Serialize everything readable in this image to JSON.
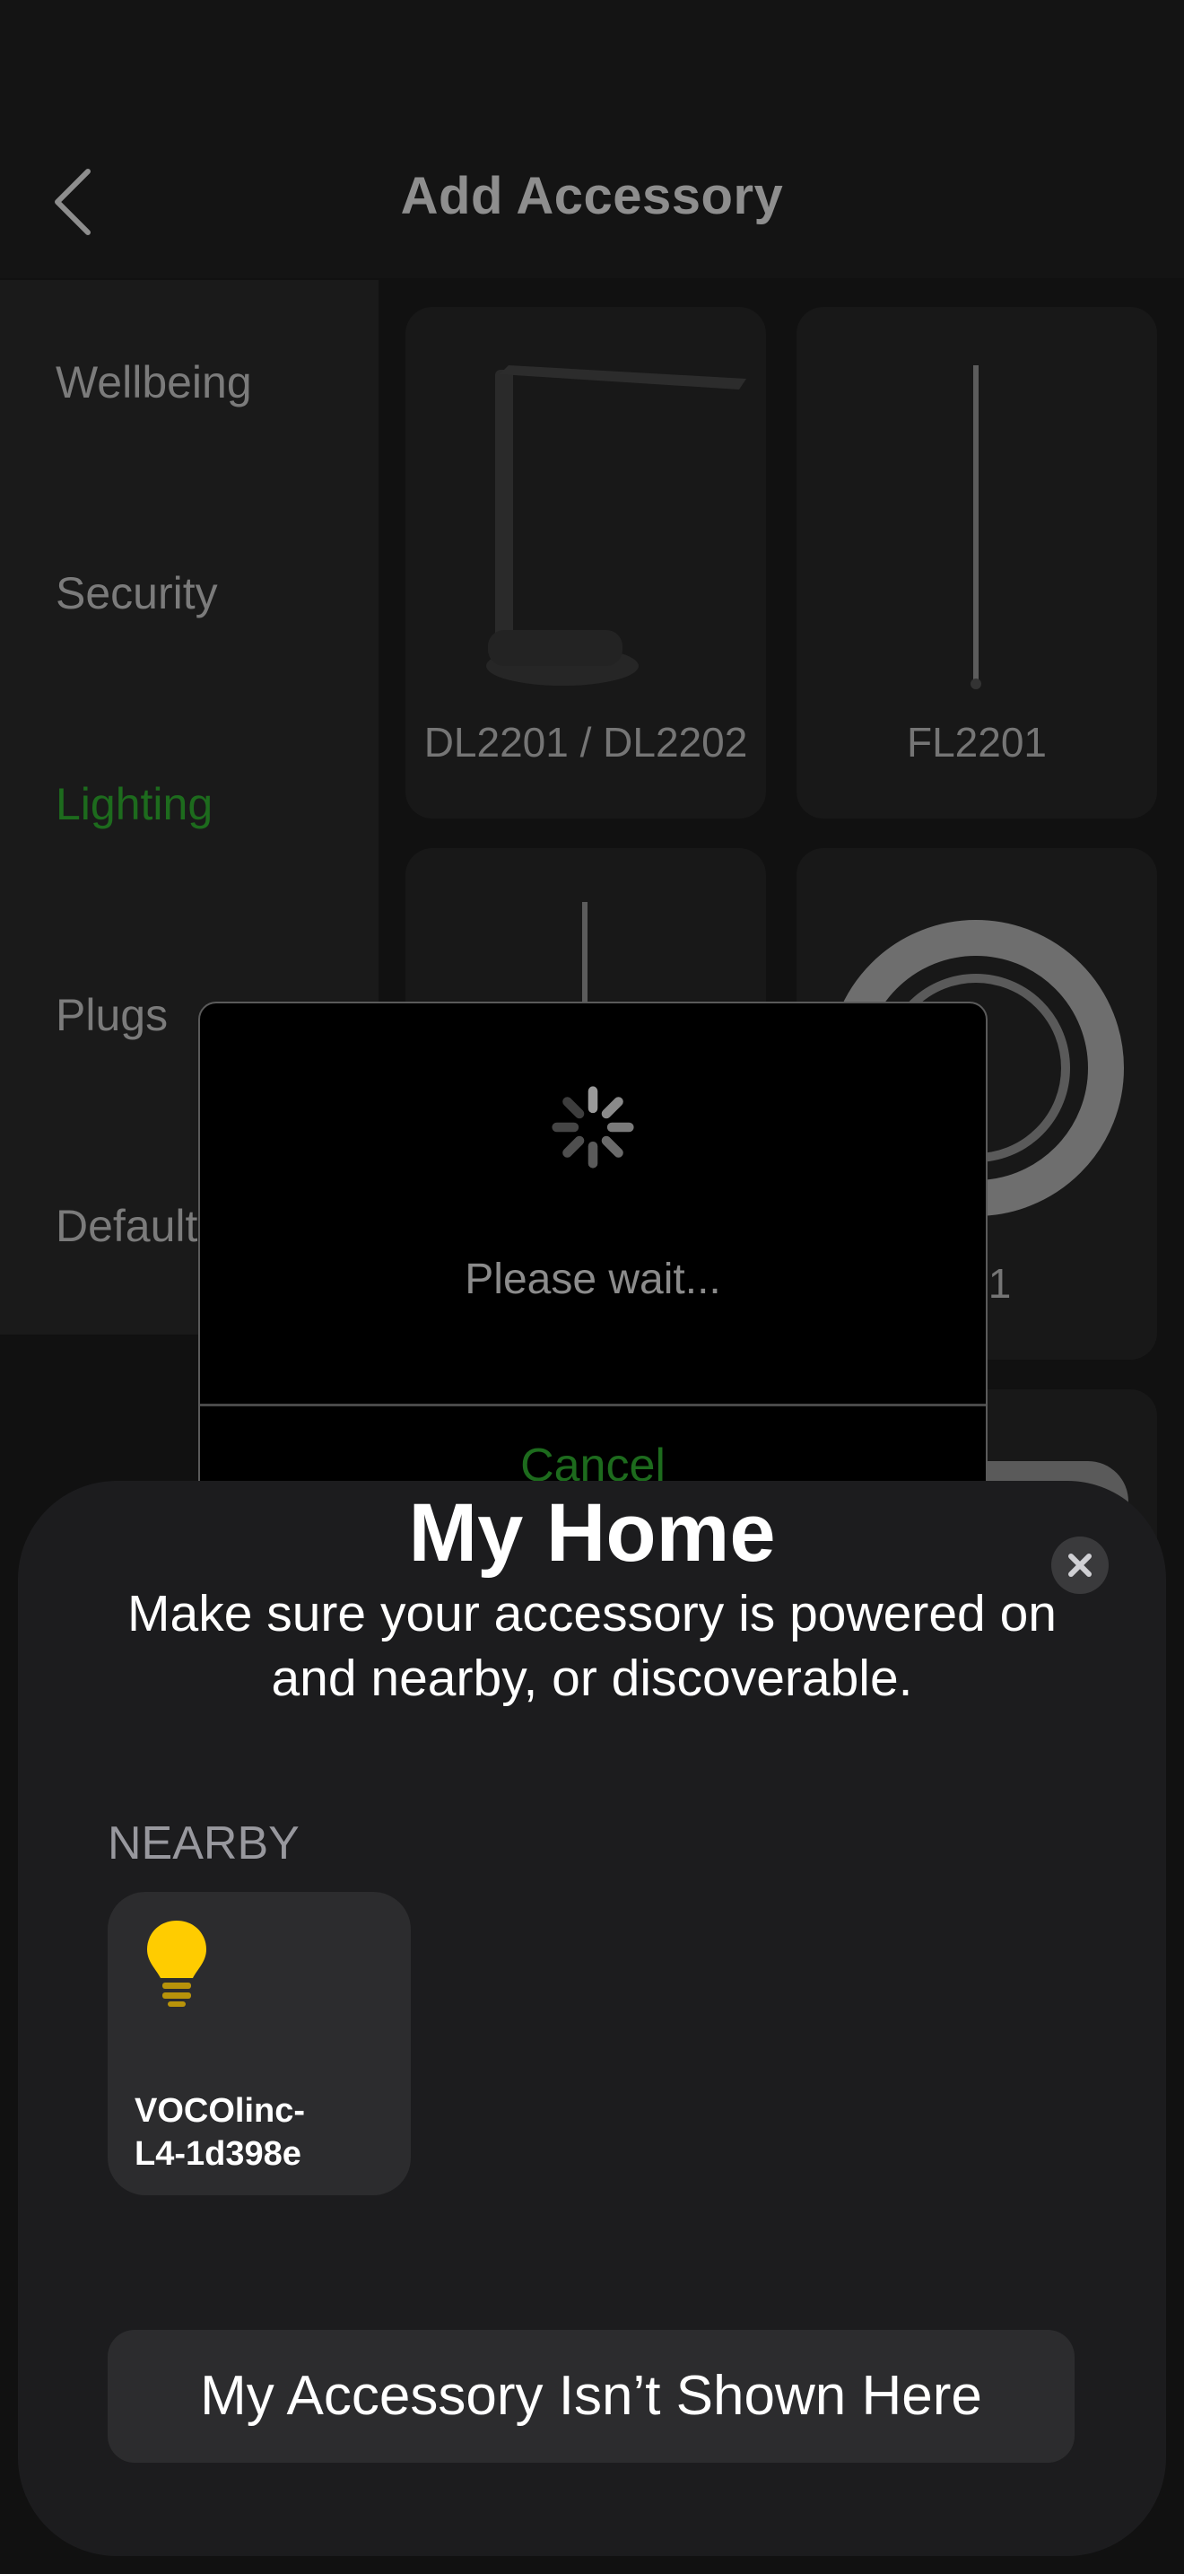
{
  "header": {
    "title": "Add Accessory",
    "back_icon": "chevron-left-icon"
  },
  "sidebar": {
    "items": [
      {
        "label": "Wellbeing"
      },
      {
        "label": "Security"
      },
      {
        "label": "Lighting",
        "active": true
      },
      {
        "label": "Plugs"
      },
      {
        "label": "Default"
      }
    ]
  },
  "products": [
    {
      "label": "DL2201 / DL2202"
    },
    {
      "label": "FL2201"
    },
    {
      "label": ""
    },
    {
      "label": "201"
    }
  ],
  "wait_dialog": {
    "message": "Please wait...",
    "cancel_label": "Cancel"
  },
  "sheet": {
    "title": "My Home",
    "subtitle": "Make sure your accessory is powered on and nearby, or discoverable.",
    "nearby_label": "NEARBY",
    "accessories": [
      {
        "name": "VOCOlinc-\nL4-1d398e",
        "icon": "lightbulb-icon"
      }
    ],
    "not_shown_label": "My Accessory Isn’t Shown Here"
  },
  "colors": {
    "accent_green": "#1d6b1d",
    "bulb_yellow": "#ffcc00",
    "sheet_bg": "#1c1c1e"
  }
}
